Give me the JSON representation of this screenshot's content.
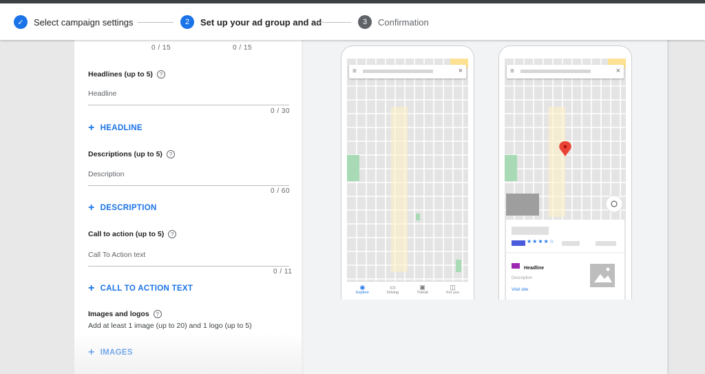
{
  "stepper": {
    "steps": [
      {
        "number": "✓",
        "label": "Select campaign settings"
      },
      {
        "number": "2",
        "label": "Set up your ad group and ad"
      },
      {
        "number": "3",
        "label": "Confirmation"
      }
    ]
  },
  "form": {
    "top_counters": [
      "0 / 15",
      "0 / 15"
    ],
    "headlines": {
      "title": "Headlines (up to 5)",
      "placeholder": "Headline",
      "counter": "0 / 30",
      "add_label": "HEADLINE"
    },
    "descriptions": {
      "title": "Descriptions (up to 5)",
      "placeholder": "Description",
      "counter": "0 / 60",
      "add_label": "DESCRIPTION"
    },
    "call_to_action": {
      "title": "Call to action (up to 5)",
      "placeholder": "Call To Action text",
      "counter": "0 / 11",
      "add_label": "CALL TO ACTION TEXT"
    },
    "images": {
      "title": "Images and logos",
      "subtitle": "Add at least 1 image (up to 20) and 1 logo (up to 5)",
      "add_label": "IMAGES"
    },
    "help_glyph": "?",
    "plus_glyph": "+"
  },
  "preview": {
    "nav": [
      {
        "icon": "explore-icon",
        "glyph": "◉",
        "label": "Explore"
      },
      {
        "icon": "driving-icon",
        "glyph": "▭",
        "label": "Driving"
      },
      {
        "icon": "transit-icon",
        "glyph": "▣",
        "label": "Transit"
      },
      {
        "icon": "for-you-icon",
        "glyph": "◫",
        "label": "For you"
      }
    ],
    "card": {
      "headline": "Headline",
      "description": "Description",
      "visit_site": "Visit site",
      "stars": "★★★★☆"
    },
    "menu_glyph": "≡",
    "close_glyph": "×",
    "colors": {
      "accent": "#1a73e8",
      "pin": "#ea4335",
      "park": "#a8dab5",
      "highway": "#fde293"
    }
  }
}
